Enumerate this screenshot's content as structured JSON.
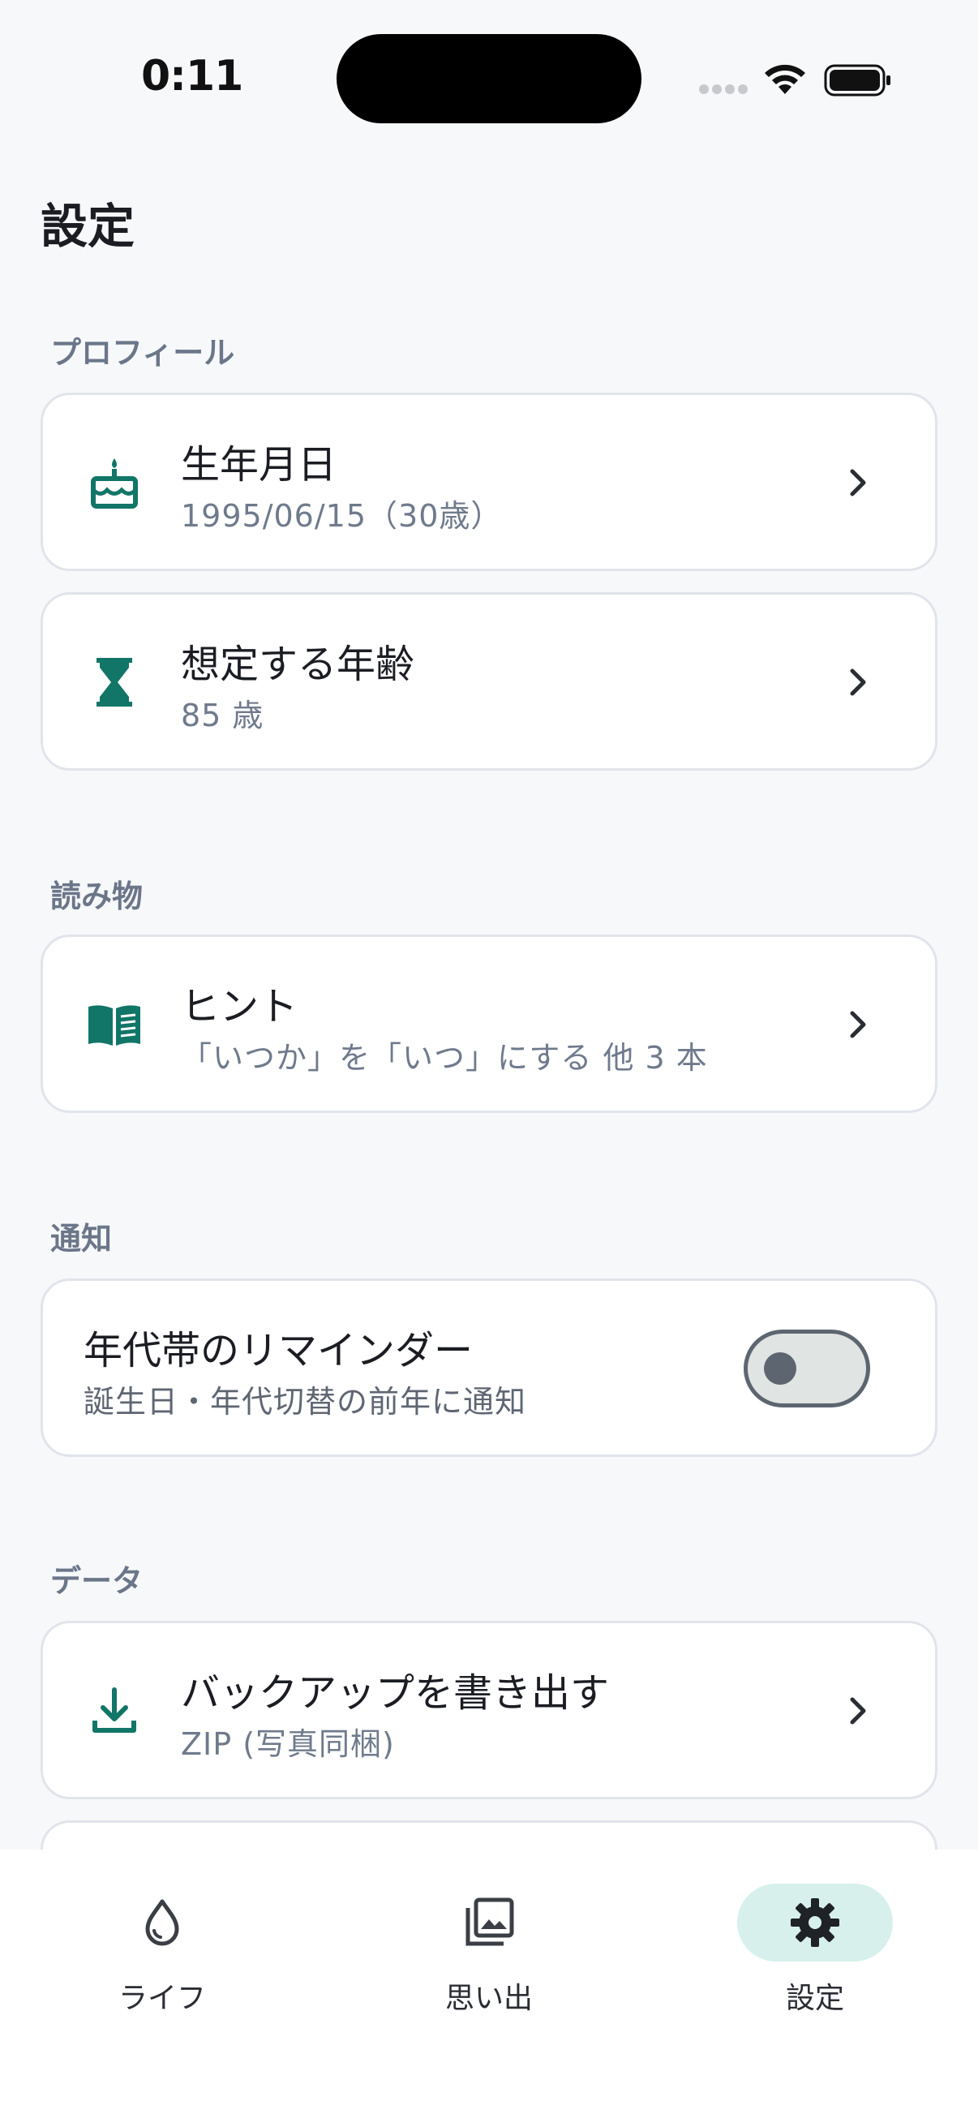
{
  "status_bar": {
    "time": "0:11",
    "signal_icon": "cellular-signal-icon",
    "wifi_icon": "wifi-icon",
    "battery_icon": "battery-icon"
  },
  "page": {
    "title": "設定"
  },
  "sections": {
    "profile": {
      "label": "プロフィール",
      "birthday": {
        "title": "生年月日",
        "subtitle": "1995/06/15（30歳）",
        "icon": "birthday-cake-icon"
      },
      "expected_age": {
        "title": "想定する年齢",
        "subtitle": "85 歳",
        "icon": "hourglass-icon"
      }
    },
    "reading": {
      "label": "読み物",
      "tips": {
        "title": "ヒント",
        "subtitle": "「いつか」を「いつ」にする 他 3 本",
        "icon": "book-icon"
      }
    },
    "notifications": {
      "label": "通知",
      "reminder": {
        "title": "年代帯のリマインダー",
        "subtitle": "誕生日・年代切替の前年に通知",
        "enabled": false
      }
    },
    "data": {
      "label": "データ",
      "export": {
        "title": "バックアップを書き出す",
        "subtitle": "ZIP (写真同梱)",
        "icon": "download-icon"
      }
    }
  },
  "bottom_nav": {
    "items": [
      {
        "label": "ライフ",
        "icon": "water-drop-icon",
        "active": false
      },
      {
        "label": "思い出",
        "icon": "photo-library-icon",
        "active": false
      },
      {
        "label": "設定",
        "icon": "gear-icon",
        "active": true
      }
    ]
  },
  "colors": {
    "accent": "#117567",
    "active_pill": "#d7f0ec",
    "background": "#f7f8fa",
    "section_label": "#6b7689"
  }
}
